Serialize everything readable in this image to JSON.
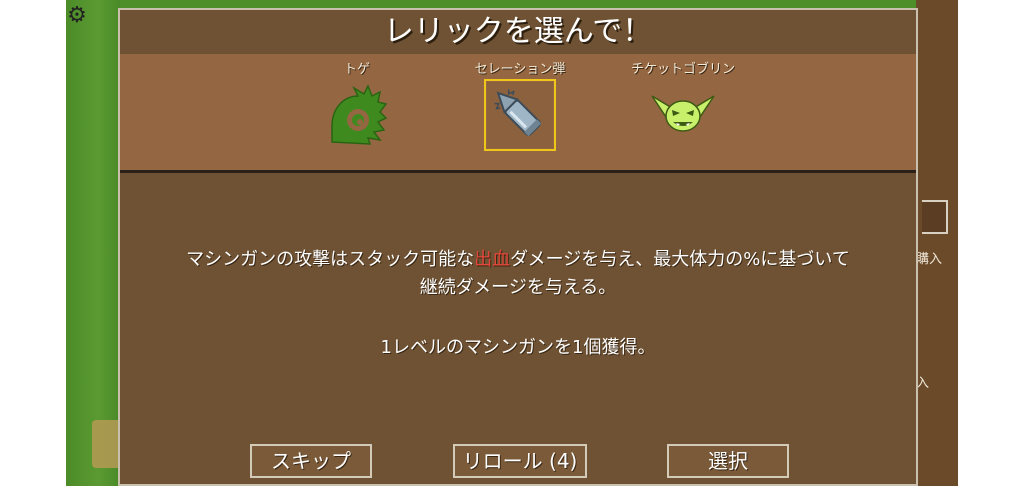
{
  "panel": {
    "title": "レリックを選んで！"
  },
  "relics": [
    {
      "name": "トゲ",
      "icon": "thorn-icon",
      "color": "#3f8a1f"
    },
    {
      "name": "セレーション弾",
      "icon": "serrated-bullet-icon",
      "color": "#9fb6c6",
      "selected": true
    },
    {
      "name": "チケットゴブリン",
      "icon": "goblin-icon",
      "color": "#c8f06a"
    }
  ],
  "description": {
    "line1_before": "マシンガンの攻撃はスタック可能な",
    "line1_highlight": "出血",
    "line1_after": "ダメージを与え、最大体力の%に基づいて",
    "line2": "継続ダメージを与える。",
    "line3": "1レベルのマシンガンを1個獲得。",
    "highlight_color": "#e4473a"
  },
  "buttons": {
    "skip": "スキップ",
    "reroll": "リロール (4)",
    "select": "選択"
  },
  "background": {
    "stall_text_1": "購入",
    "stall_text_2": "入"
  },
  "colors": {
    "panel": "#6e5233",
    "relic_row": "#946742",
    "selection": "#f0c619",
    "grass": "#4f8f2a"
  }
}
